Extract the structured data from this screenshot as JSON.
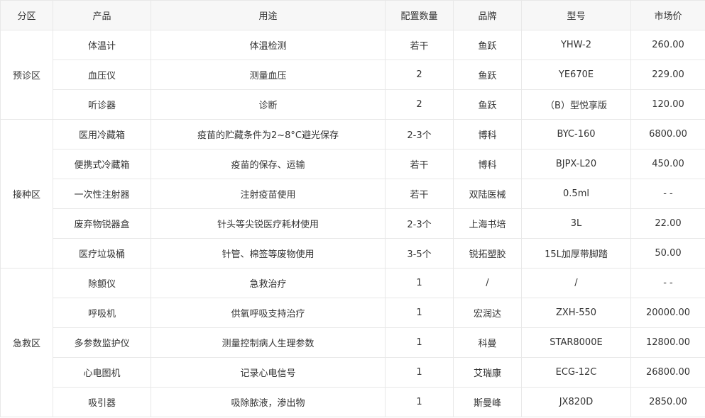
{
  "table": {
    "headers": [
      "分区",
      "产品",
      "用途",
      "配置数量",
      "品牌",
      "型号",
      "市场价"
    ],
    "groups": [
      {
        "zone": "预诊区",
        "rows": [
          [
            "体温计",
            "体温检测",
            "若干",
            "鱼跃",
            "YHW-2",
            "260.00"
          ],
          [
            "血压仪",
            "测量血压",
            "2",
            "鱼跃",
            "YE670E",
            "229.00"
          ],
          [
            "听诊器",
            "诊断",
            "2",
            "鱼跃",
            "（B）型悦享版",
            "120.00"
          ]
        ]
      },
      {
        "zone": "接种区",
        "rows": [
          [
            "医用冷藏箱",
            "疫苗的贮藏条件为2~8°C避光保存",
            "2-3个",
            "博科",
            "BYC-160",
            "6800.00"
          ],
          [
            "便携式冷藏箱",
            "疫苗的保存、运输",
            "若干",
            "博科",
            "BJPX-L20",
            "450.00"
          ],
          [
            "一次性注射器",
            "注射疫苗使用",
            "若干",
            "双陆医械",
            "0.5ml",
            "- -"
          ],
          [
            "废弃物锐器盒",
            "针头等尖锐医疗耗材使用",
            "2-3个",
            "上海书培",
            "3L",
            "22.00"
          ],
          [
            "医疗垃圾桶",
            "针管、棉签等废物使用",
            "3-5个",
            "锐拓塑胶",
            "15L加厚带脚踏",
            "50.00"
          ]
        ]
      },
      {
        "zone": "急救区",
        "rows": [
          [
            "除颤仪",
            "急救治疗",
            "1",
            "/",
            "/",
            "- -"
          ],
          [
            "呼吸机",
            "供氧呼吸支持治疗",
            "1",
            "宏润达",
            "ZXH-550",
            "20000.00"
          ],
          [
            "多参数监护仪",
            "测量控制病人生理参数",
            "1",
            "科曼",
            "STAR8000E",
            "12800.00"
          ],
          [
            "心电图机",
            "记录心电信号",
            "1",
            "艾瑞康",
            "ECG-12C",
            "26800.00"
          ],
          [
            "吸引器",
            "吸除脓液，渗出物",
            "1",
            "斯曼峰",
            "JX820D",
            "2850.00"
          ]
        ]
      }
    ]
  }
}
